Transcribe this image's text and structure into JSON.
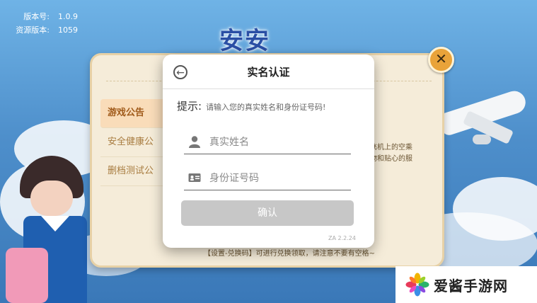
{
  "version_info": {
    "version_label": "版本号:",
    "version_value": "1.0.9",
    "resource_label": "资源版本:",
    "resource_value": "1059"
  },
  "game_logo_text": "安安",
  "notice_board": {
    "tabs": [
      "游戏公告",
      "安全健康公",
      "删档测试公"
    ],
    "snippet_line1": "飞机上的空乘",
    "snippet_line2": "物和贴心的服",
    "snippet_bottom": "【设置-兑换码】可进行兑换领取，请注意不要有空格~"
  },
  "modal": {
    "title": "实名认证",
    "tip_label": "提示:",
    "tip_message": "请输入您的真实姓名和身份证号码!",
    "name_placeholder": "真实姓名",
    "id_placeholder": "身份证号码",
    "confirm_label": "确认",
    "build_tag": "ZA 2.2.24"
  },
  "icons": {
    "back": "arrow-left-circle-icon",
    "close": "close-icon",
    "name": "person-icon",
    "id": "id-card-icon"
  },
  "colors": {
    "close_button": "#e9a33a",
    "confirm_disabled": "#c7c7c7",
    "active_tab": "#f9dcb9"
  },
  "watermark": {
    "text": "爱酱手游网"
  }
}
